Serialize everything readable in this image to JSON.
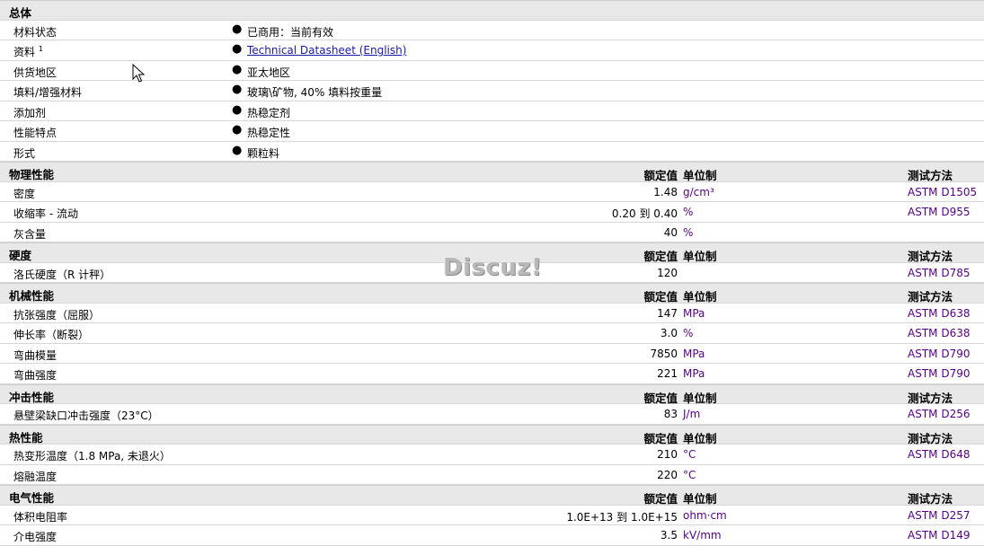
{
  "watermark": "Discuz!",
  "general": {
    "title": "总体",
    "rows": [
      {
        "label": "材料状态",
        "value": "已商用：当前有效"
      },
      {
        "label": "资料",
        "sup": "1",
        "value": "Technical Datasheet (English)"
      },
      {
        "label": "供货地区",
        "value": "亚太地区"
      },
      {
        "label": "填料/增强材料",
        "value": "玻璃\\矿物, 40% 填料按重量"
      },
      {
        "label": "添加剂",
        "value": "热稳定剂"
      },
      {
        "label": "性能特点",
        "value": "热稳定性"
      },
      {
        "label": "形式",
        "value": "颗粒料"
      }
    ]
  },
  "columns": {
    "nominal": "额定值",
    "unit": "单位制",
    "test": "测试方法"
  },
  "sections": [
    {
      "title": "物理性能",
      "rows": [
        {
          "label": "密度",
          "nominal": "1.48",
          "unit": "g/cm³",
          "test": "ASTM D1505"
        },
        {
          "label": "收缩率 - 流动",
          "nominal_from": "0.20",
          "to": "到",
          "nominal_to": "0.40",
          "unit": "%",
          "test": "ASTM D955"
        },
        {
          "label": "灰含量",
          "nominal": "40",
          "unit": "%",
          "test": ""
        }
      ]
    },
    {
      "title": "硬度",
      "rows": [
        {
          "label": "洛氏硬度（R 计秤）",
          "nominal": "120",
          "unit": "",
          "test": "ASTM D785"
        }
      ]
    },
    {
      "title": "机械性能",
      "rows": [
        {
          "label": "抗张强度（屈服）",
          "nominal": "147",
          "unit": "MPa",
          "test": "ASTM D638"
        },
        {
          "label": "伸长率（断裂）",
          "nominal": "3.0",
          "unit": "%",
          "test": "ASTM D638"
        },
        {
          "label": "弯曲模量",
          "nominal": "7850",
          "unit": "MPa",
          "test": "ASTM D790"
        },
        {
          "label": "弯曲强度",
          "nominal": "221",
          "unit": "MPa",
          "test": "ASTM D790"
        }
      ]
    },
    {
      "title": "冲击性能",
      "rows": [
        {
          "label": "悬壁梁缺口冲击强度（23°C）",
          "nominal": "83",
          "unit": "J/m",
          "test": "ASTM D256"
        }
      ]
    },
    {
      "title": "热性能",
      "rows": [
        {
          "label": "热变形温度（1.8 MPa, 未退火）",
          "nominal": "210",
          "unit": "°C",
          "test": "ASTM D648"
        },
        {
          "label": "熔融温度",
          "nominal": "220",
          "unit": "°C",
          "test": ""
        }
      ]
    },
    {
      "title": "电气性能",
      "rows": [
        {
          "label": "体积电阻率",
          "nominal_from": "1.0E+13",
          "to": "到",
          "nominal_to": "1.0E+15",
          "unit": "ohm·cm",
          "test": "ASTM D257"
        },
        {
          "label": "介电强度",
          "nominal": "3.5",
          "unit": "kV/mm",
          "test": "ASTM D149"
        }
      ]
    }
  ]
}
